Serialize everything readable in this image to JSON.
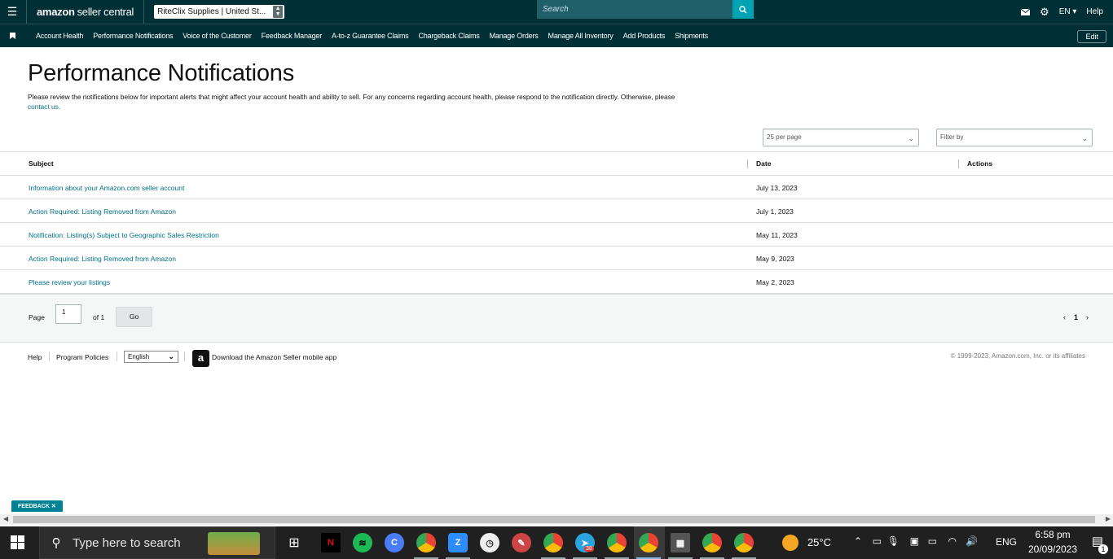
{
  "topbar": {
    "brand_amazon": "amazon",
    "brand_suffix": "seller central",
    "store": "RiteClix Supplies | United St...",
    "search_placeholder": "Search",
    "language": "EN",
    "help": "Help"
  },
  "nav": {
    "items": [
      "Account Health",
      "Performance Notifications",
      "Voice of the Customer",
      "Feedback Manager",
      "A-to-z Guarantee Claims",
      "Chargeback Claims",
      "Manage Orders",
      "Manage All Inventory",
      "Add Products",
      "Shipments"
    ],
    "edit": "Edit"
  },
  "page": {
    "title": "Performance Notifications",
    "intro": "Please review the notifications below for important alerts that might affect your account health and ability to sell. For any concerns regarding account health, please respond to the notification directly. Otherwise, please",
    "contact_link": "contact us."
  },
  "controls": {
    "per_page": "25 per page",
    "filter": "Filter by"
  },
  "table": {
    "headers": {
      "subject": "Subject",
      "date": "Date",
      "actions": "Actions"
    },
    "rows": [
      {
        "subject": "Information about your Amazon.com seller account",
        "date": "July 13, 2023"
      },
      {
        "subject": "Action Required: Listing Removed from Amazon",
        "date": "July 1, 2023"
      },
      {
        "subject": "Notification: Listing(s) Subject to Geographic Sales Restriction",
        "date": "May 11, 2023"
      },
      {
        "subject": "Action Required: Listing Removed from Amazon",
        "date": "May 9, 2023"
      },
      {
        "subject": "Please review your listings",
        "date": "May 2, 2023"
      }
    ]
  },
  "pager": {
    "page_label": "Page",
    "page_value": "1",
    "of_label": "of 1",
    "go": "Go",
    "current": "1"
  },
  "footer": {
    "help": "Help",
    "policies": "Program Policies",
    "language": "English",
    "app_text": "Download the Amazon Seller mobile app",
    "copyright": "© 1999-2023, Amazon.com, Inc. or its affiliates"
  },
  "feedback": "FEEDBACK",
  "taskbar": {
    "search_placeholder": "Type here to search",
    "temperature": "25°C",
    "lang": "ENG",
    "time": "6:58 pm",
    "date": "20/09/2023",
    "telegram_badge": "38",
    "notifications": "1"
  },
  "colors": {
    "header_bg": "#002f36",
    "link": "#007185",
    "search_btn": "#00a3b4",
    "feedback": "#008296"
  }
}
